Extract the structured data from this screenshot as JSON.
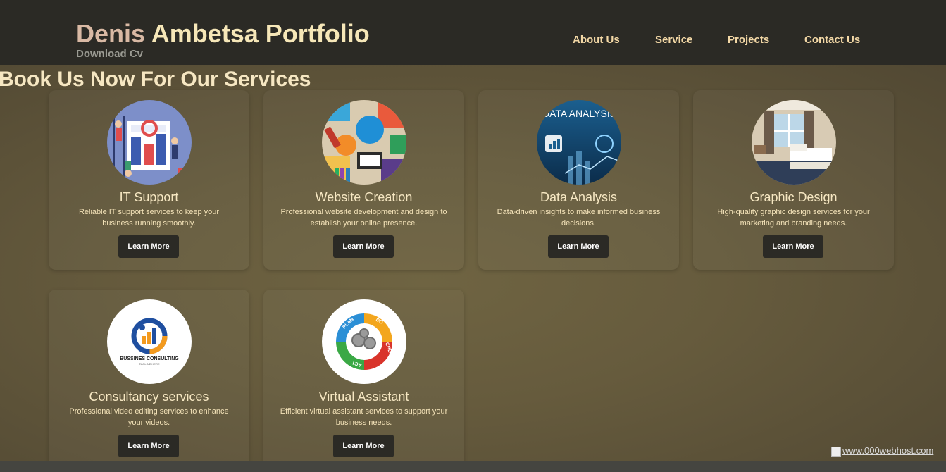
{
  "header": {
    "brand_first": "Denis",
    "brand_rest": "Ambetsa Portfolio",
    "download_cv": "Download Cv",
    "nav": [
      {
        "label": "About Us"
      },
      {
        "label": "Service"
      },
      {
        "label": "Projects"
      },
      {
        "label": "Contact Us"
      }
    ]
  },
  "main": {
    "section_title": "Book Us Now For Our Services",
    "services": [
      {
        "title": "IT Support",
        "description": "Reliable IT support services to keep your business running smoothly.",
        "button": "Learn More",
        "icon": "it-support-illustration"
      },
      {
        "title": "Website Creation",
        "description": "Professional website development and design to establish your online presence.",
        "button": "Learn More",
        "icon": "web-design-collage"
      },
      {
        "title": "Data Analysis",
        "description": "Data-driven insights to make informed business decisions.",
        "button": "Learn More",
        "icon": "data-analysis-dashboard",
        "image_text": "DATA ANALYSIS"
      },
      {
        "title": "Graphic Design",
        "description": "High-quality graphic design services for your marketing and branding needs.",
        "button": "Learn More",
        "icon": "hotel-room-photo"
      },
      {
        "title": "Consultancy services",
        "description": "Professional video editing services to enhance your videos.",
        "button": "Learn More",
        "icon": "business-consulting-logo",
        "image_text": "BUSSINES CONSULTING",
        "image_subtext": "TAGLINE HERE"
      },
      {
        "title": "Virtual Assistant",
        "description": "Efficient virtual assistant services to support your business needs.",
        "button": "Learn More",
        "icon": "pdca-cycle-diagram",
        "image_labels": [
          "PLAN",
          "DO",
          "CHECK",
          "ACT"
        ]
      }
    ]
  },
  "footer": {
    "hosting_badge": "www.000webhost.com"
  },
  "colors": {
    "header_bg": "#2b2a25",
    "page_bg": "#665b3d",
    "nav_text": "#f3d8a6",
    "button_bg": "#2b2a25"
  }
}
